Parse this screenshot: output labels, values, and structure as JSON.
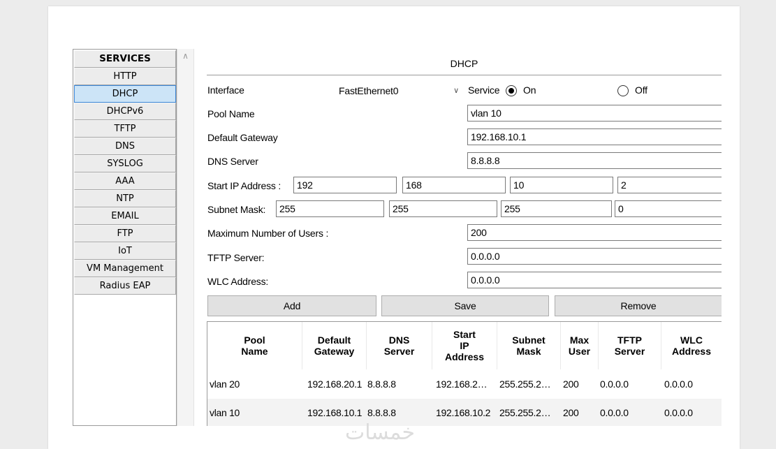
{
  "services": {
    "header": "SERVICES",
    "items": [
      "HTTP",
      "DHCP",
      "DHCPv6",
      "TFTP",
      "DNS",
      "SYSLOG",
      "AAA",
      "NTP",
      "EMAIL",
      "FTP",
      "IoT",
      "VM Management",
      "Radius EAP"
    ],
    "active": "DHCP"
  },
  "dhcp": {
    "title": "DHCP",
    "interface_label": "Interface",
    "interface_value": "FastEthernet0",
    "service_label": "Service",
    "on_label": "On",
    "off_label": "Off",
    "service_state": "On",
    "pool_name_label": "Pool Name",
    "pool_name": "vlan 10",
    "default_gateway_label": "Default Gateway",
    "default_gateway": "192.168.10.1",
    "dns_server_label": "DNS Server",
    "dns_server": "8.8.8.8",
    "start_ip_label": "Start IP Address :",
    "start_ip": [
      "192",
      "168",
      "10",
      "2"
    ],
    "subnet_mask_label": "Subnet Mask:",
    "subnet_mask": [
      "255",
      "255",
      "255",
      "0"
    ],
    "max_users_label": "Maximum Number of Users :",
    "max_users": "200",
    "tftp_server_label": "TFTP Server:",
    "tftp_server": "0.0.0.0",
    "wlc_address_label": "WLC Address:",
    "wlc_address": "0.0.0.0",
    "buttons": {
      "add": "Add",
      "save": "Save",
      "remove": "Remove"
    }
  },
  "table": {
    "headers": [
      [
        "Pool",
        "Name"
      ],
      [
        "Default",
        "Gateway"
      ],
      [
        "DNS",
        "Server"
      ],
      [
        "Start",
        "IP",
        "Address"
      ],
      [
        "Subnet",
        "Mask"
      ],
      [
        "Max",
        "User"
      ],
      [
        "TFTP",
        "Server"
      ],
      [
        "WLC",
        "Address"
      ]
    ],
    "rows": [
      [
        "vlan 20",
        "192.168.20.1",
        "8.8.8.8",
        "192.168.2…",
        "255.255.2…",
        "200",
        "0.0.0.0",
        "0.0.0.0"
      ],
      [
        "vlan 10",
        "192.168.10.1",
        "8.8.8.8",
        "192.168.10.2",
        "255.255.2…",
        "200",
        "0.0.0.0",
        "0.0.0.0"
      ]
    ]
  },
  "watermark": "خمسات"
}
